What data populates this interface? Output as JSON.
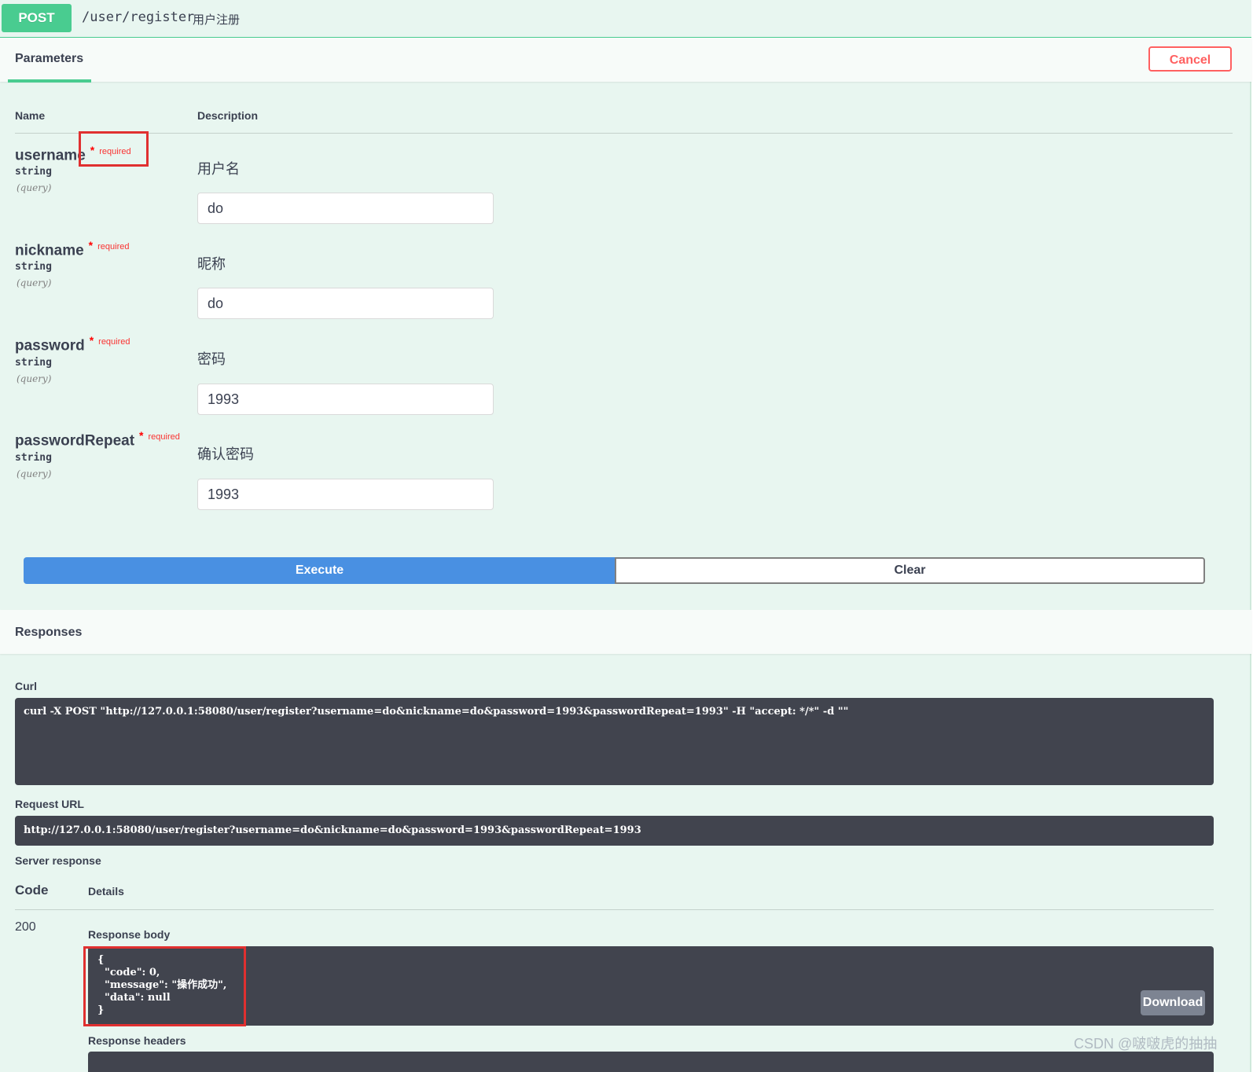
{
  "operation": {
    "method": "POST",
    "path": "/user/register",
    "summary": "用户注册"
  },
  "tabs": {
    "parameters": "Parameters"
  },
  "buttons": {
    "cancel": "Cancel",
    "execute": "Execute",
    "clear": "Clear",
    "download": "Download"
  },
  "columns": {
    "name": "Name",
    "description": "Description"
  },
  "parameters": [
    {
      "name": "username",
      "star": "*",
      "required": "required",
      "type": "string",
      "in": "(query)",
      "description": "用户名",
      "value": "do"
    },
    {
      "name": "nickname",
      "star": "*",
      "required": "required",
      "type": "string",
      "in": "(query)",
      "description": "昵称",
      "value": "do"
    },
    {
      "name": "password",
      "star": "*",
      "required": "required",
      "type": "string",
      "in": "(query)",
      "description": "密码",
      "value": "1993"
    },
    {
      "name": "passwordRepeat",
      "star": "*",
      "required": "required",
      "type": "string",
      "in": "(query)",
      "description": "确认密码",
      "value": "1993"
    }
  ],
  "responses": {
    "title": "Responses",
    "curl_label": "Curl",
    "curl": "curl -X POST \"http://127.0.0.1:58080/user/register?username=do&nickname=do&password=1993&passwordRepeat=1993\" -H \"accept: */*\" -d \"\"",
    "request_url_label": "Request URL",
    "request_url": "http://127.0.0.1:58080/user/register?username=do&nickname=do&password=1993&passwordRepeat=1993",
    "server_response_label": "Server response",
    "code_header": "Code",
    "details_header": "Details",
    "status_code": "200",
    "response_body_label": "Response body",
    "response_body": "{\n  \"code\": 0,\n  \"message\": \"操作成功\",\n  \"data\": null\n}",
    "response_headers_label": "Response headers"
  },
  "watermark": "CSDN @啵啵虎的抽抽",
  "colors": {
    "post_green": "#49cc90",
    "execute_blue": "#4990e2",
    "cancel_red": "#ff6060",
    "code_bg": "#41444e",
    "highlight_red": "#e03030"
  }
}
